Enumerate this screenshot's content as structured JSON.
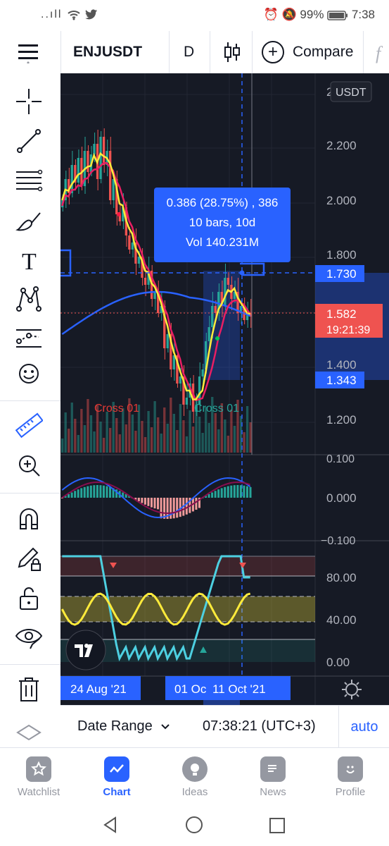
{
  "status_bar": {
    "signal": "..ıll",
    "battery": "99%",
    "time": "7:38"
  },
  "toolbar": {
    "symbol": "ENJUSDT",
    "interval": "D",
    "compare_label": "Compare"
  },
  "price_axis": {
    "currency": "USDT",
    "labels": [
      "2.200",
      "2.000",
      "1.800",
      "1.400",
      "1.200"
    ],
    "top_partial": "2",
    "crosshair_price": "1.730",
    "last_price": "1.582",
    "countdown": "19:21:39",
    "range_low_price": "1.343"
  },
  "measure_tooltip": {
    "line1": "0.386 (28.75%) , 386",
    "line2": "10 bars, 10d",
    "line3": "Vol 140.231M"
  },
  "cross_labels": [
    "Cross 01",
    "Cross 01"
  ],
  "macd_axis": [
    "0.100",
    "0.000",
    "−0.100"
  ],
  "osc_axis": [
    "80.00",
    "40.00",
    "0.00"
  ],
  "time_axis": {
    "left_label": "24 Aug '21",
    "mid_label_a": "01 Oc",
    "mid_label_b": "11 Oct '21"
  },
  "bottom_bar": {
    "date_range": "Date Range",
    "clock": "07:38:21 (UTC+3)",
    "auto": "auto"
  },
  "nav": {
    "items": [
      {
        "label": "Watchlist",
        "icon": "star-icon"
      },
      {
        "label": "Chart",
        "icon": "chart-icon"
      },
      {
        "label": "Ideas",
        "icon": "bulb-icon"
      },
      {
        "label": "News",
        "icon": "news-icon"
      },
      {
        "label": "Profile",
        "icon": "smile-icon"
      }
    ],
    "active": "Chart"
  },
  "colors": {
    "bg": "#161a25",
    "up": "#26a69a",
    "down": "#ef5350",
    "accent": "#2962ff",
    "ema_fast": "#ffeb3b",
    "ema_slow": "#e91e63",
    "ma_blue": "#2962ff",
    "osc": "#4dd0e1"
  }
}
